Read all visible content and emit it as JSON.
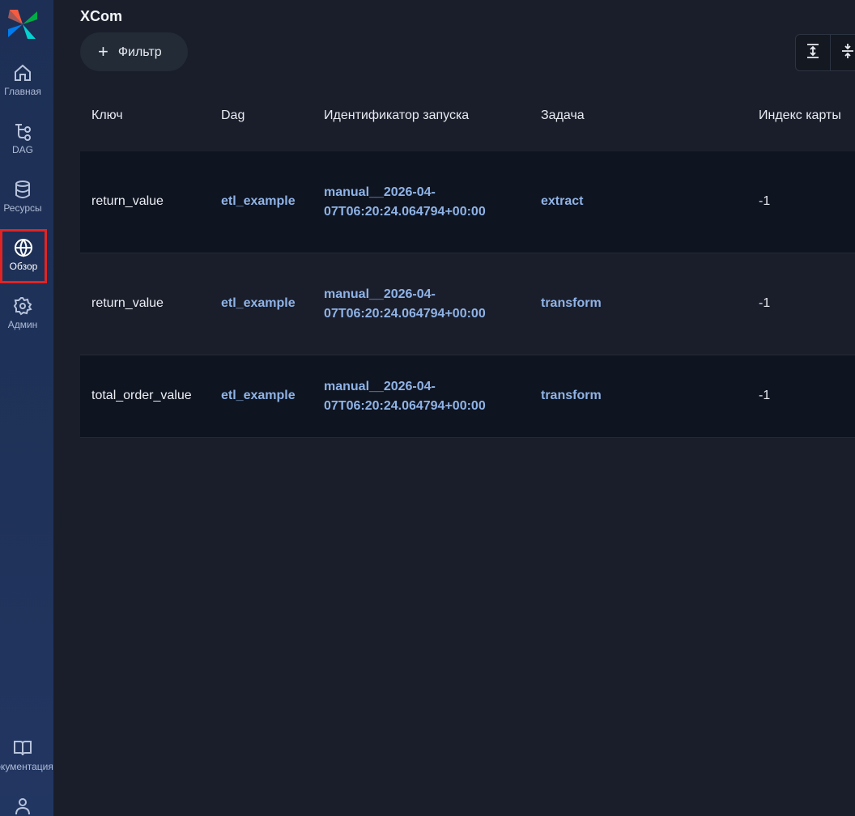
{
  "sidebar": {
    "items": [
      {
        "label": "Главная",
        "icon": "home-icon"
      },
      {
        "label": "DAG",
        "icon": "dag-icon"
      },
      {
        "label": "Ресурсы",
        "icon": "database-icon"
      },
      {
        "label": "Обзор",
        "icon": "globe-icon",
        "active": true
      },
      {
        "label": "Админ",
        "icon": "gear-icon"
      }
    ],
    "bottom": [
      {
        "label": "Документация",
        "icon": "book-icon"
      },
      {
        "label": "",
        "icon": "user-icon"
      }
    ]
  },
  "page": {
    "title": "XCom",
    "filter_label": "Фильтр"
  },
  "table": {
    "headers": {
      "key": "Ключ",
      "dag": "Dag",
      "run_id": "Идентификатор запуска",
      "task": "Задача",
      "map_index": "Индекс карты"
    },
    "rows": [
      {
        "key": "return_value",
        "dag": "etl_example",
        "run_id_1": "manual__2026-04-",
        "run_id_2": "07T06:20:24.064794+00:00",
        "task": "extract",
        "map_index": "-1"
      },
      {
        "key": "return_value",
        "dag": "etl_example",
        "run_id_1": "manual__2026-04-",
        "run_id_2": "07T06:20:24.064794+00:00",
        "task": "transform",
        "map_index": "-1"
      },
      {
        "key": "total_order_value",
        "dag": "etl_example",
        "run_id_1": "manual__2026-04-",
        "run_id_2": "07T06:20:24.064794+00:00",
        "task": "transform",
        "map_index": "-1"
      }
    ]
  },
  "colors": {
    "accent_link": "#8fb3e6",
    "active_highlight": "#e02424",
    "sidebar_bg": "#1f3259",
    "main_bg": "#1a1e2b"
  }
}
